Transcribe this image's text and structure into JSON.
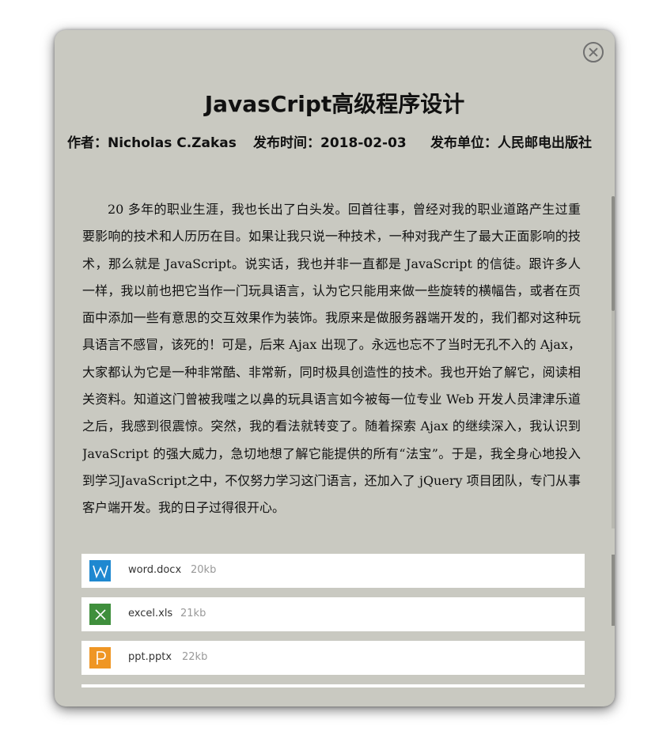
{
  "article": {
    "title": "JavasCript高级程序设计",
    "author": "作者：Nicholas C.Zakas",
    "date": "发布时间：2018-02-03",
    "publisher": "发布单位：人民邮电出版社",
    "body": "20 多年的职业生涯，我也长出了白头发。回首往事，曾经对我的职业道路产生过重要影响的技术和人历历在目。如果让我只说一种技术，一种对我产生了最大正面影响的技术，那么就是 JavaScript。说实话，我也并非一直都是 JavaScript 的信徒。跟许多人一样，我以前也把它当作一门玩具语言，认为它只能用来做一些旋转的横幅告，或者在页面中添加一些有意思的交互效果作为装饰。我原来是做服务器端开发的，我们都对这种玩具语言不感冒，该死的！可是，后来 Ajax 出现了。永远也忘不了当时无孔不入的 Ajax，大家都认为它是一种非常酷、非常新，同时极具创造性的技术。我也开始了解它，阅读相关资料。知道这门曾被我嗤之以鼻的玩具语言如今被每一位专业 Web 开发人员津津乐道之后，我感到很震惊。突然，我的看法就转变了。随着探索 Ajax 的继续深入，我认识到JavaScript 的强大威力，急切地想了解它能提供的所有“法宝”。于是，我全身心地投入到学习JavaScript之中，不仅努力学习这门语言，还加入了 jQuery 项目团队，专门从事客户端开发。我的日子过得很开心。"
  },
  "attachments": [
    {
      "name": "word.docx",
      "size": "20kb",
      "icon": "word-icon",
      "color": "#1e88d0",
      "glyph": "W"
    },
    {
      "name": "excel.xls",
      "size": "21kb",
      "icon": "excel-icon",
      "color": "#3f8f3c",
      "glyph": "X"
    },
    {
      "name": "ppt.pptx",
      "size": "22kb",
      "icon": "ppt-icon",
      "color": "#ef9624",
      "glyph": "P"
    }
  ],
  "colors": {
    "dialog_bg": "#c9c9c1",
    "word": "#1e88d0",
    "excel": "#3f8f3c",
    "ppt": "#ef9624"
  }
}
